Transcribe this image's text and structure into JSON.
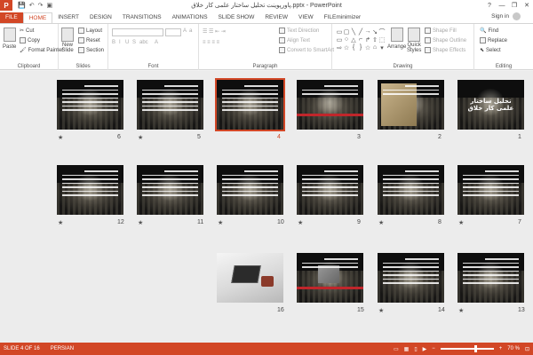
{
  "window": {
    "title": "پاورپوینت تحلیل ساختار علمی کار خلاق.pptx - PowerPoint",
    "app_initial": "P",
    "controls": [
      "?",
      "—",
      "❐",
      "✕"
    ]
  },
  "quick_access": [
    "💾",
    "↶",
    "↷",
    "▣"
  ],
  "tabs": [
    "FILE",
    "HOME",
    "INSERT",
    "DESIGN",
    "TRANSITIONS",
    "ANIMATIONS",
    "SLIDE SHOW",
    "REVIEW",
    "VIEW",
    "FILEminimizer"
  ],
  "active_tab": "HOME",
  "signin": "Sign in",
  "ribbon": {
    "clipboard": {
      "label": "Clipboard",
      "paste": "Paste",
      "cut": "Cut",
      "copy": "Copy",
      "format_painter": "Format Painter"
    },
    "slides": {
      "label": "Slides",
      "new_slide": "New",
      "new_slide2": "Slide",
      "layout": "Layout",
      "reset": "Reset",
      "section": "Section"
    },
    "font": {
      "label": "Font"
    },
    "paragraph": {
      "label": "Paragraph",
      "text_direction": "Text Direction",
      "align_text": "Align Text",
      "convert_smartart": "Convert to SmartArt"
    },
    "drawing": {
      "label": "Drawing",
      "arrange": "Arrange",
      "quick_styles": "Quick",
      "quick_styles2": "Styles",
      "shape_fill": "Shape Fill",
      "shape_outline": "Shape Outline",
      "shape_effects": "Shape Effects"
    },
    "editing": {
      "label": "Editing",
      "find": "Find",
      "replace": "Replace",
      "select": "Select"
    }
  },
  "slides": [
    {
      "n": "1",
      "kind": "title",
      "title": "تحلیل ساختار علمی کار خلاق",
      "star": false
    },
    {
      "n": "2",
      "kind": "map",
      "star": false
    },
    {
      "n": "3",
      "kind": "redbar",
      "star": false
    },
    {
      "n": "4",
      "kind": "text",
      "star": false,
      "selected": true
    },
    {
      "n": "5",
      "kind": "text",
      "star": true
    },
    {
      "n": "6",
      "kind": "text",
      "star": true
    },
    {
      "n": "7",
      "kind": "text",
      "star": true
    },
    {
      "n": "8",
      "kind": "text",
      "star": true
    },
    {
      "n": "9",
      "kind": "text",
      "star": true
    },
    {
      "n": "10",
      "kind": "text",
      "star": true
    },
    {
      "n": "11",
      "kind": "text",
      "star": true
    },
    {
      "n": "12",
      "kind": "text",
      "star": true
    },
    {
      "n": "13",
      "kind": "text",
      "star": true
    },
    {
      "n": "14",
      "kind": "text",
      "star": true
    },
    {
      "n": "15",
      "kind": "photo",
      "star": false
    },
    {
      "n": "16",
      "kind": "laptop",
      "star": false
    }
  ],
  "status": {
    "slide_of": "SLIDE 4 OF 16",
    "language": "PERSIAN",
    "zoom": "70 %"
  }
}
